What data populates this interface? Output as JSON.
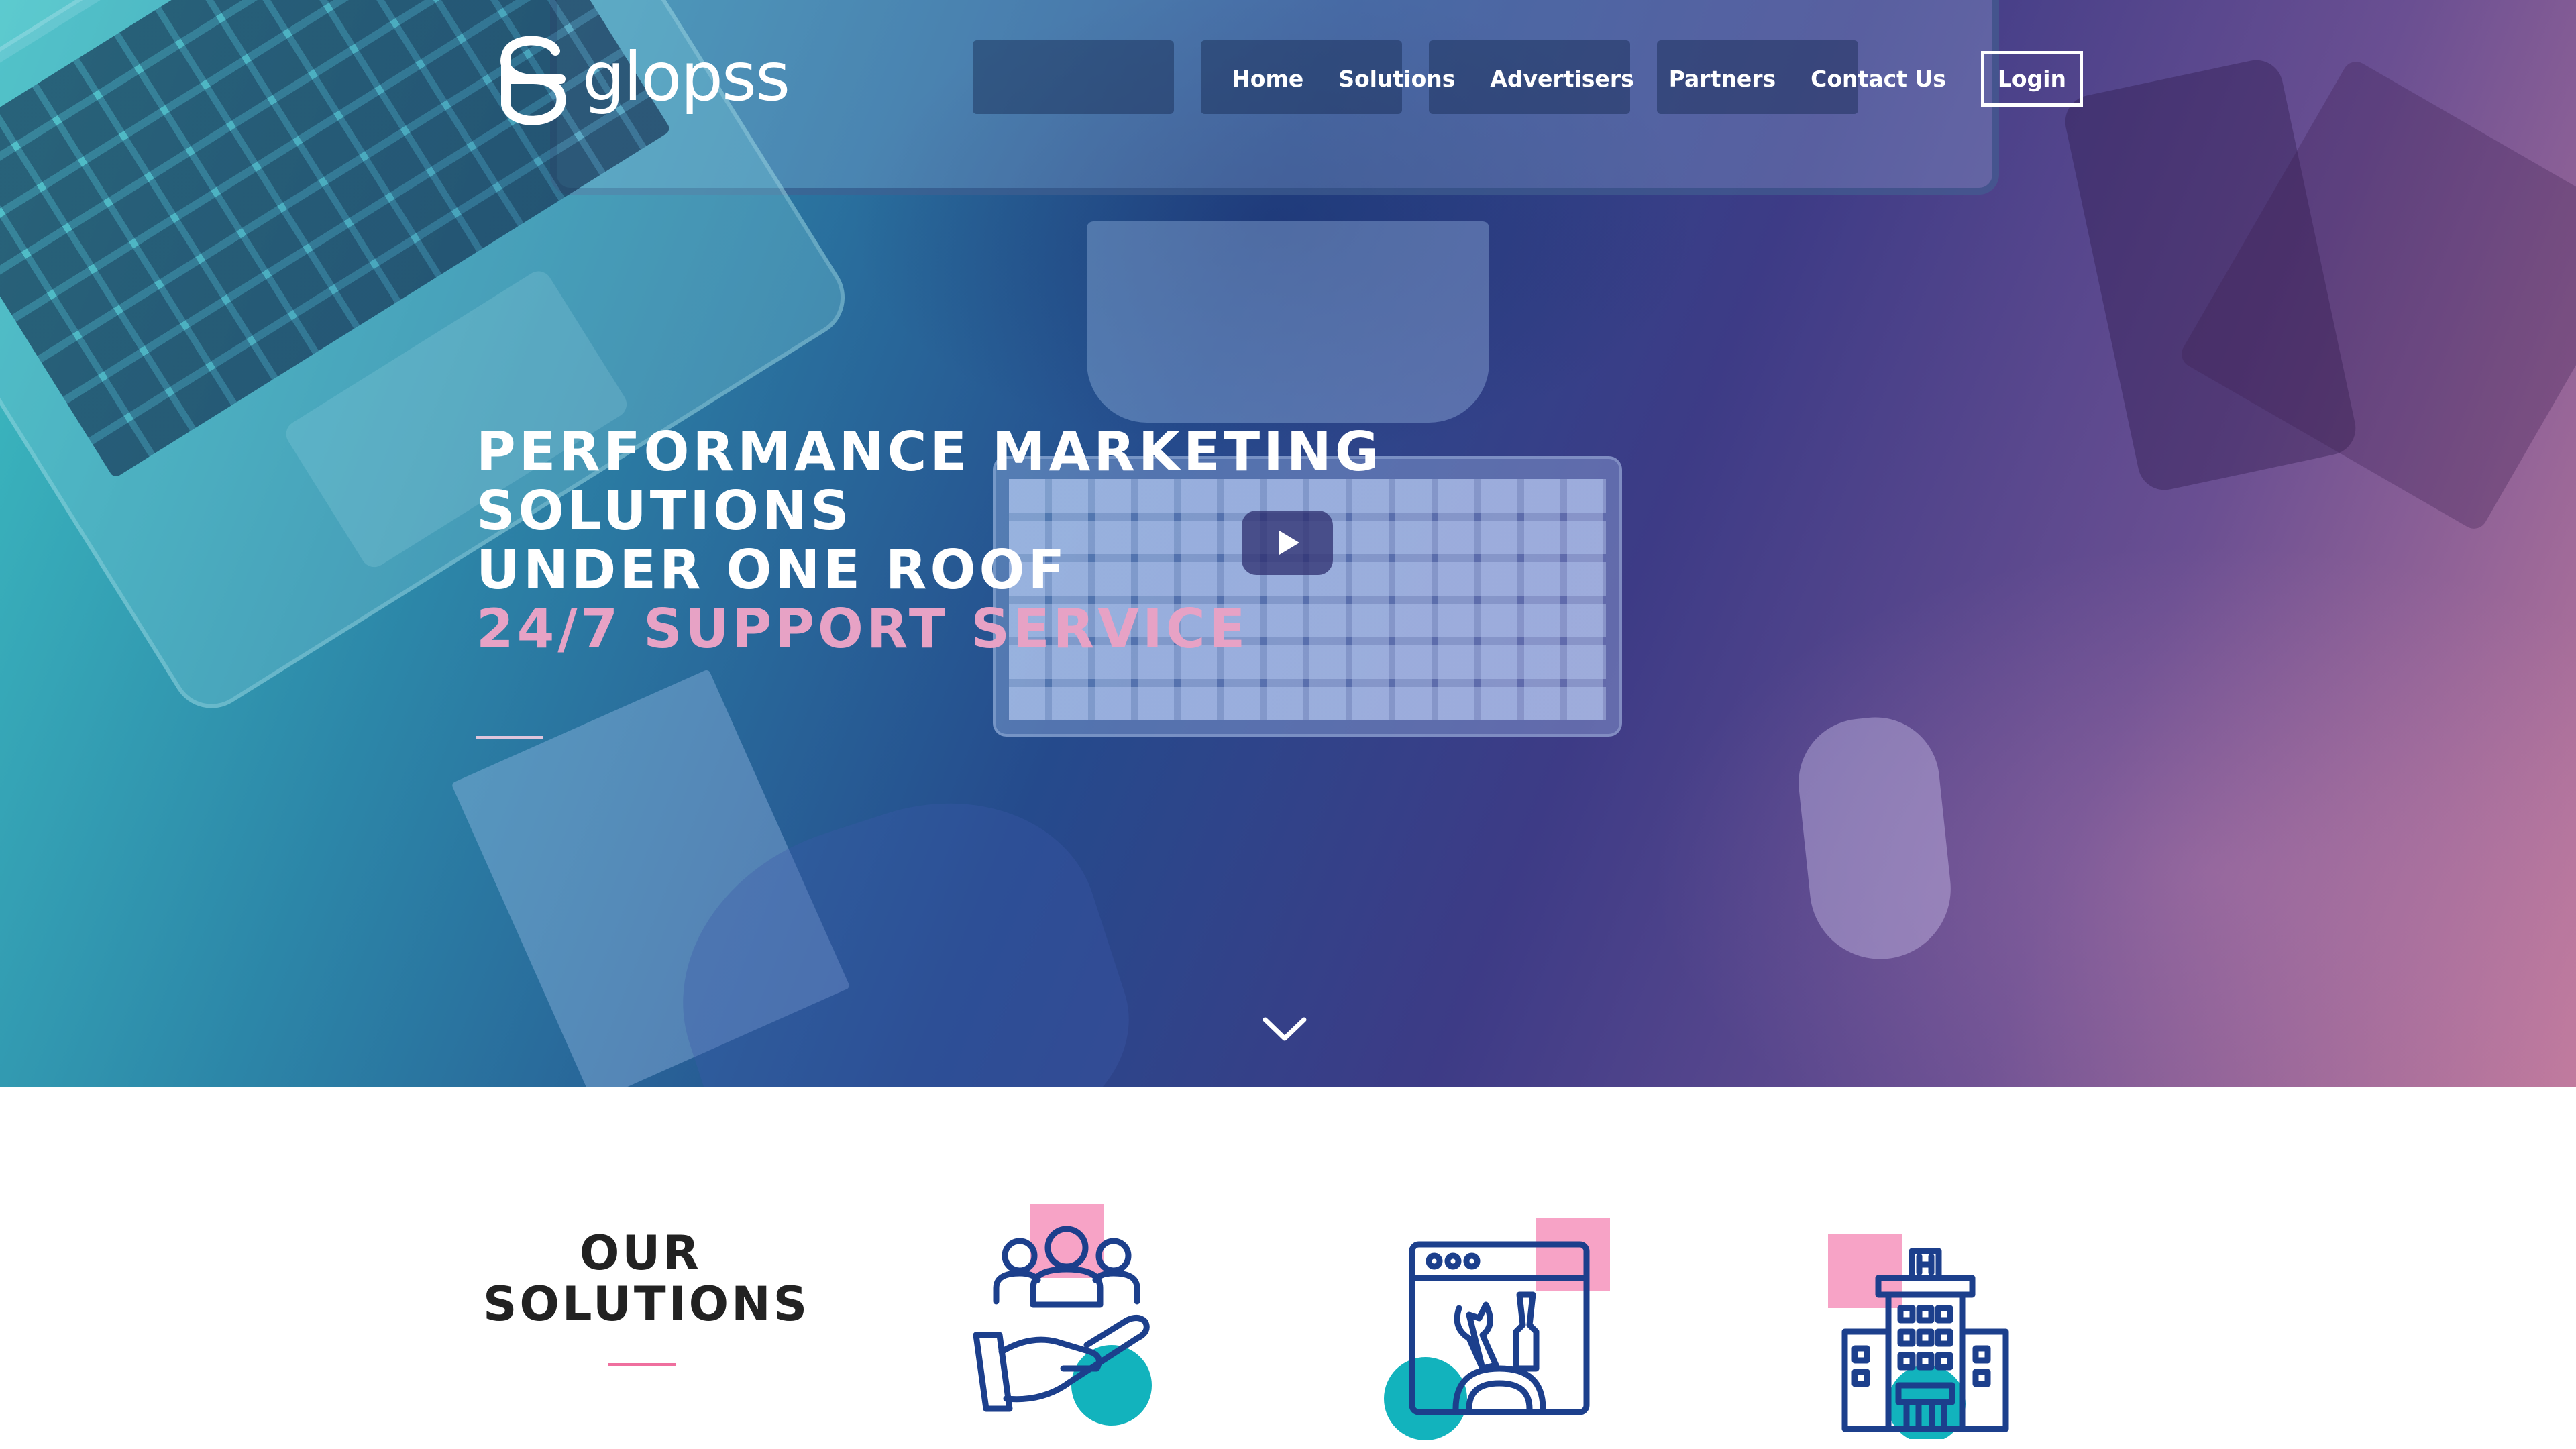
{
  "brand": {
    "name": "glopss",
    "accent_pink": "#e7a2c5",
    "teal": "#12b3bd",
    "navy": "#1c3f8c",
    "square_pink": "#f7a3c6"
  },
  "nav": {
    "items": [
      "Home",
      "Solutions",
      "Advertisers",
      "Partners",
      "Contact Us"
    ],
    "login_label": "Login"
  },
  "hero": {
    "line1": "PERFORMANCE MARKETING",
    "line2": "SOLUTIONS",
    "line3": "UNDER ONE ROOF",
    "line4": "24/7 SUPPORT SERVICE",
    "play_icon": "play-icon",
    "scroll_icon": "chevron-down-icon"
  },
  "solutions": {
    "title_line1": "OUR",
    "title_line2": "SOLUTIONS",
    "icons": [
      "people-hand-icon",
      "browser-tools-icon",
      "hospital-building-icon"
    ]
  }
}
